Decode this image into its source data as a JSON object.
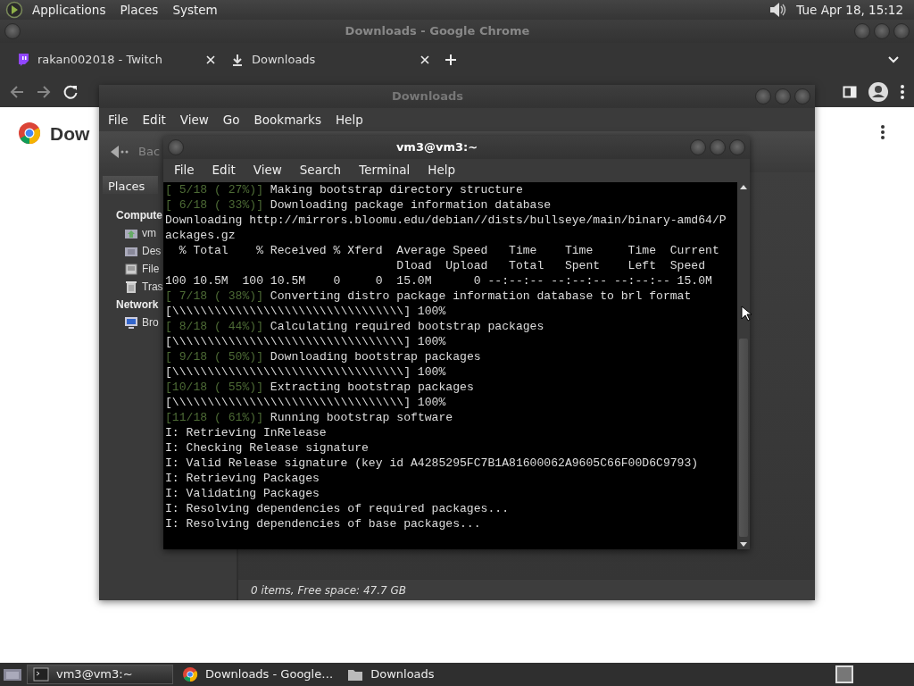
{
  "top_panel": {
    "menus": [
      "Applications",
      "Places",
      "System"
    ],
    "clock": "Tue Apr 18, 15:12"
  },
  "browser": {
    "title": "Downloads - Google Chrome",
    "tabs": [
      {
        "label": "rakan002018 - Twitch",
        "kind": "twitch"
      },
      {
        "label": "Downloads",
        "kind": "download"
      }
    ],
    "page_heading": "Dow"
  },
  "file_manager": {
    "title": "Downloads",
    "menus": [
      "File",
      "Edit",
      "View",
      "Go",
      "Bookmarks",
      "Help"
    ],
    "back_label": "Bac",
    "sidebar": {
      "heading": "Places",
      "sections": [
        {
          "label": "Compute",
          "items": [
            {
              "label": "vm",
              "kind": "home"
            },
            {
              "label": "Des",
              "kind": "desktop"
            },
            {
              "label": "File",
              "kind": "drive"
            },
            {
              "label": "Tras",
              "kind": "trash"
            }
          ]
        },
        {
          "label": "Network",
          "items": [
            {
              "label": "Bro",
              "kind": "network"
            }
          ]
        }
      ]
    },
    "status": "0 items, Free space: 47.7 GB"
  },
  "terminal": {
    "title": "vm3@vm3:~",
    "menus": [
      "File",
      "Edit",
      "View",
      "Search",
      "Terminal",
      "Help"
    ],
    "lines": [
      {
        "prefix": "[ 5/18 ( 27%)]",
        "text": " Making bootstrap directory structure"
      },
      {
        "prefix": "[ 6/18 ( 33%)]",
        "text": " Downloading package information database"
      },
      {
        "text": "Downloading http://mirrors.bloomu.edu/debian//dists/bullseye/main/binary-amd64/P"
      },
      {
        "text": "ackages.gz"
      },
      {
        "text": "  % Total    % Received % Xferd  Average Speed   Time    Time     Time  Current"
      },
      {
        "text": "                                 Dload  Upload   Total   Spent    Left  Speed"
      },
      {
        "text": "100 10.5M  100 10.5M    0     0  15.0M      0 --:--:-- --:--:-- --:--:-- 15.0M"
      },
      {
        "prefix": "[ 7/18 ( 38%)]",
        "text": " Converting distro package information database to brl format"
      },
      {
        "text": "[\\\\\\\\\\\\\\\\\\\\\\\\\\\\\\\\\\\\\\\\\\\\\\\\\\\\\\\\\\\\\\\\\\] 100%"
      },
      {
        "prefix": "[ 8/18 ( 44%)]",
        "text": " Calculating required bootstrap packages"
      },
      {
        "text": "[\\\\\\\\\\\\\\\\\\\\\\\\\\\\\\\\\\\\\\\\\\\\\\\\\\\\\\\\\\\\\\\\\\] 100%"
      },
      {
        "prefix": "[ 9/18 ( 50%)]",
        "text": " Downloading bootstrap packages"
      },
      {
        "text": "[\\\\\\\\\\\\\\\\\\\\\\\\\\\\\\\\\\\\\\\\\\\\\\\\\\\\\\\\\\\\\\\\\\] 100%"
      },
      {
        "prefix": "[10/18 ( 55%)]",
        "text": " Extracting bootstrap packages"
      },
      {
        "text": "[\\\\\\\\\\\\\\\\\\\\\\\\\\\\\\\\\\\\\\\\\\\\\\\\\\\\\\\\\\\\\\\\\\] 100%"
      },
      {
        "prefix": "[11/18 ( 61%)]",
        "text": " Running bootstrap software"
      },
      {
        "text": "I: Retrieving InRelease"
      },
      {
        "text": "I: Checking Release signature"
      },
      {
        "text": "I: Valid Release signature (key id A4285295FC7B1A81600062A9605C66F00D6C9793)"
      },
      {
        "text": "I: Retrieving Packages"
      },
      {
        "text": "I: Validating Packages"
      },
      {
        "text": "I: Resolving dependencies of required packages..."
      },
      {
        "text": "I: Resolving dependencies of base packages..."
      }
    ]
  },
  "taskbar": {
    "tasks": [
      {
        "label": "vm3@vm3:~",
        "kind": "terminal",
        "selected": true
      },
      {
        "label": "Downloads - Google…",
        "kind": "browser",
        "selected": false
      },
      {
        "label": "Downloads",
        "kind": "folder",
        "selected": false
      }
    ]
  }
}
